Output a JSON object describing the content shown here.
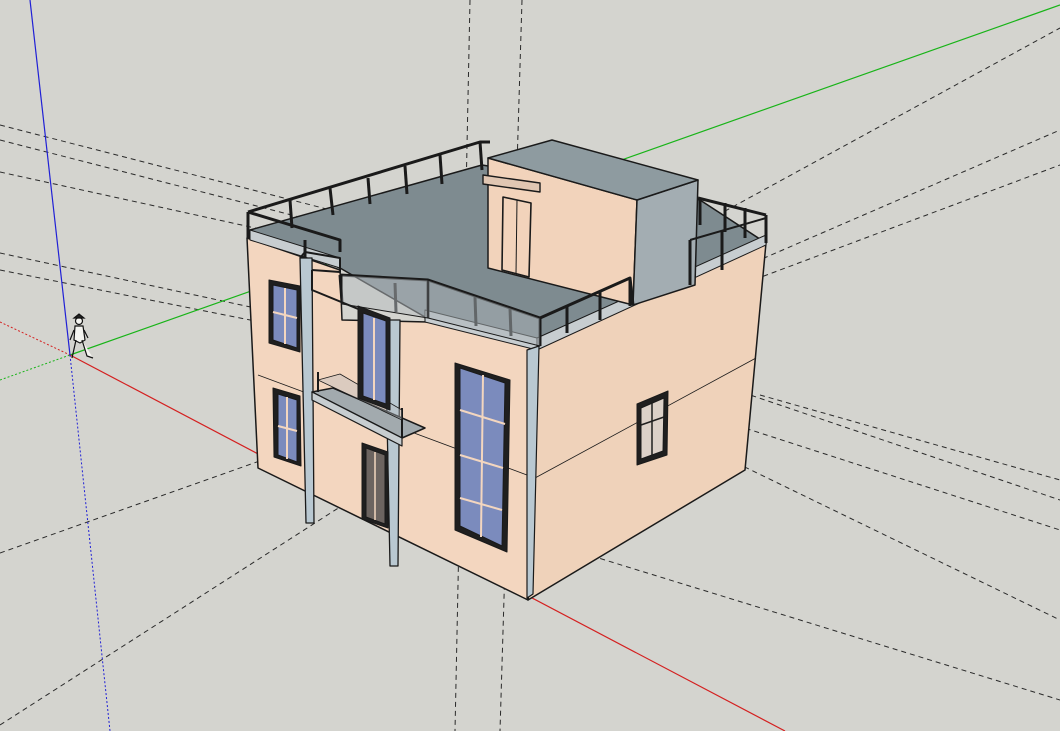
{
  "scene": {
    "background": "#d4d4cf",
    "wall_color": "#f0d4bc",
    "wall_shade_color": "#e9cab3",
    "roof_color": "#7e8b90",
    "roof_side_color": "#a3adb2",
    "glass_color": "#7b8bbd",
    "pipe_color": "#b9c8d1",
    "edge_color": "#1a1a1a",
    "guide_color": "#222222"
  },
  "axes": {
    "red": "#d42020",
    "green": "#18b418",
    "blue": "#2020d6"
  },
  "icons": [
    "person-figure-icon"
  ]
}
